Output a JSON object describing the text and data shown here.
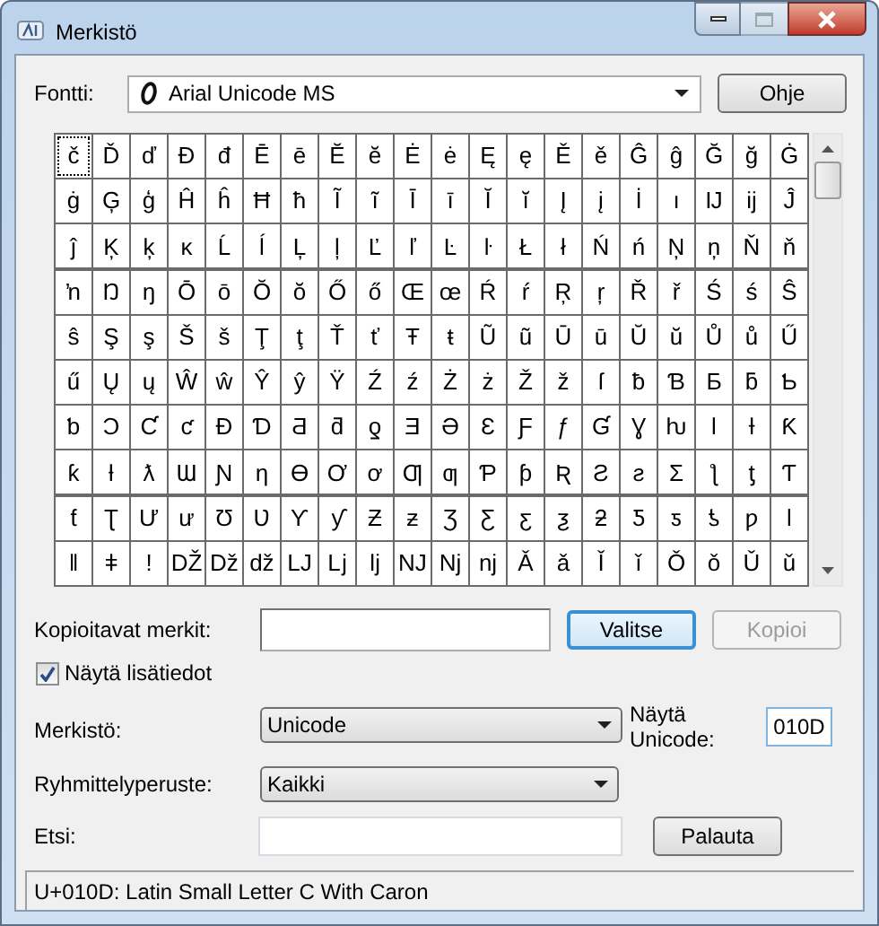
{
  "window": {
    "title": "Merkistö"
  },
  "font": {
    "label": "Fontti:",
    "value": "Arial Unicode MS"
  },
  "help_button": "Ohje",
  "grid": {
    "rows": [
      [
        {
          "char": "č",
          "selected": true
        },
        {
          "char": "Ď",
          "selected": false
        },
        {
          "char": "ď",
          "selected": false
        },
        {
          "char": "Đ",
          "selected": false
        },
        {
          "char": "đ",
          "selected": false
        },
        {
          "char": "Ē",
          "selected": false
        },
        {
          "char": "ē",
          "selected": false
        },
        {
          "char": "Ĕ",
          "selected": false
        },
        {
          "char": "ĕ",
          "selected": false
        },
        {
          "char": "Ė",
          "selected": false
        },
        {
          "char": "ė",
          "selected": false
        },
        {
          "char": "Ę",
          "selected": false
        },
        {
          "char": "ę",
          "selected": false
        },
        {
          "char": "Ě",
          "selected": false
        },
        {
          "char": "ě",
          "selected": false
        },
        {
          "char": "Ĝ",
          "selected": false
        },
        {
          "char": "ĝ",
          "selected": false
        },
        {
          "char": "Ğ",
          "selected": false
        },
        {
          "char": "ğ",
          "selected": false
        },
        {
          "char": "Ġ",
          "selected": false
        }
      ],
      [
        {
          "char": "ġ",
          "selected": false
        },
        {
          "char": "Ģ",
          "selected": false
        },
        {
          "char": "ģ",
          "selected": false
        },
        {
          "char": "Ĥ",
          "selected": false
        },
        {
          "char": "ĥ",
          "selected": false
        },
        {
          "char": "Ħ",
          "selected": false
        },
        {
          "char": "ħ",
          "selected": false
        },
        {
          "char": "Ĩ",
          "selected": false
        },
        {
          "char": "ĩ",
          "selected": false
        },
        {
          "char": "Ī",
          "selected": false
        },
        {
          "char": "ī",
          "selected": false
        },
        {
          "char": "Ĭ",
          "selected": false
        },
        {
          "char": "ĭ",
          "selected": false
        },
        {
          "char": "Į",
          "selected": false
        },
        {
          "char": "į",
          "selected": false
        },
        {
          "char": "İ",
          "selected": false
        },
        {
          "char": "ı",
          "selected": false
        },
        {
          "char": "Ĳ",
          "selected": false
        },
        {
          "char": "ĳ",
          "selected": false
        },
        {
          "char": "Ĵ",
          "selected": false
        }
      ],
      [
        {
          "char": "ĵ",
          "selected": false
        },
        {
          "char": "Ķ",
          "selected": false
        },
        {
          "char": "ķ",
          "selected": false
        },
        {
          "char": "ĸ",
          "selected": false
        },
        {
          "char": "Ĺ",
          "selected": false
        },
        {
          "char": "ĺ",
          "selected": false
        },
        {
          "char": "Ļ",
          "selected": false
        },
        {
          "char": "ļ",
          "selected": false
        },
        {
          "char": "Ľ",
          "selected": false
        },
        {
          "char": "ľ",
          "selected": false
        },
        {
          "char": "Ŀ",
          "selected": false
        },
        {
          "char": "ŀ",
          "selected": false
        },
        {
          "char": "Ł",
          "selected": false
        },
        {
          "char": "ł",
          "selected": false
        },
        {
          "char": "Ń",
          "selected": false
        },
        {
          "char": "ń",
          "selected": false
        },
        {
          "char": "Ņ",
          "selected": false
        },
        {
          "char": "ņ",
          "selected": false
        },
        {
          "char": "Ň",
          "selected": false
        },
        {
          "char": "ň",
          "selected": false
        }
      ],
      [
        {
          "char": "ŉ",
          "selected": false
        },
        {
          "char": "Ŋ",
          "selected": false
        },
        {
          "char": "ŋ",
          "selected": false
        },
        {
          "char": "Ō",
          "selected": false
        },
        {
          "char": "ō",
          "selected": false
        },
        {
          "char": "Ŏ",
          "selected": false
        },
        {
          "char": "ŏ",
          "selected": false
        },
        {
          "char": "Ő",
          "selected": false
        },
        {
          "char": "ő",
          "selected": false
        },
        {
          "char": "Œ",
          "selected": false
        },
        {
          "char": "œ",
          "selected": false
        },
        {
          "char": "Ŕ",
          "selected": false
        },
        {
          "char": "ŕ",
          "selected": false
        },
        {
          "char": "Ŗ",
          "selected": false
        },
        {
          "char": "ŗ",
          "selected": false
        },
        {
          "char": "Ř",
          "selected": false
        },
        {
          "char": "ř",
          "selected": false
        },
        {
          "char": "Ś",
          "selected": false
        },
        {
          "char": "ś",
          "selected": false
        },
        {
          "char": "Ŝ",
          "selected": false
        }
      ],
      [
        {
          "char": "ŝ",
          "selected": false
        },
        {
          "char": "Ş",
          "selected": false
        },
        {
          "char": "ş",
          "selected": false
        },
        {
          "char": "Š",
          "selected": false
        },
        {
          "char": "š",
          "selected": false
        },
        {
          "char": "Ţ",
          "selected": false
        },
        {
          "char": "ţ",
          "selected": false
        },
        {
          "char": "Ť",
          "selected": false
        },
        {
          "char": "ť",
          "selected": false
        },
        {
          "char": "Ŧ",
          "selected": false
        },
        {
          "char": "ŧ",
          "selected": false
        },
        {
          "char": "Ũ",
          "selected": false
        },
        {
          "char": "ũ",
          "selected": false
        },
        {
          "char": "Ū",
          "selected": false
        },
        {
          "char": "ū",
          "selected": false
        },
        {
          "char": "Ŭ",
          "selected": false
        },
        {
          "char": "ŭ",
          "selected": false
        },
        {
          "char": "Ů",
          "selected": false
        },
        {
          "char": "ů",
          "selected": false
        },
        {
          "char": "Ű",
          "selected": false
        }
      ],
      [
        {
          "char": "ű",
          "selected": false
        },
        {
          "char": "Ų",
          "selected": false
        },
        {
          "char": "ų",
          "selected": false
        },
        {
          "char": "Ŵ",
          "selected": false
        },
        {
          "char": "ŵ",
          "selected": false
        },
        {
          "char": "Ŷ",
          "selected": false
        },
        {
          "char": "ŷ",
          "selected": false
        },
        {
          "char": "Ÿ",
          "selected": false
        },
        {
          "char": "Ź",
          "selected": false
        },
        {
          "char": "ź",
          "selected": false
        },
        {
          "char": "Ż",
          "selected": false
        },
        {
          "char": "ż",
          "selected": false
        },
        {
          "char": "Ž",
          "selected": false
        },
        {
          "char": "ž",
          "selected": false
        },
        {
          "char": "ſ",
          "selected": false
        },
        {
          "char": "ƀ",
          "selected": false
        },
        {
          "char": "Ɓ",
          "selected": false
        },
        {
          "char": "Ƃ",
          "selected": false
        },
        {
          "char": "ƃ",
          "selected": false
        },
        {
          "char": "Ƅ",
          "selected": false
        }
      ],
      [
        {
          "char": "ƅ",
          "selected": false
        },
        {
          "char": "Ɔ",
          "selected": false
        },
        {
          "char": "Ƈ",
          "selected": false
        },
        {
          "char": "ƈ",
          "selected": false
        },
        {
          "char": "Ɖ",
          "selected": false
        },
        {
          "char": "Ɗ",
          "selected": false
        },
        {
          "char": "Ƌ",
          "selected": false
        },
        {
          "char": "ƌ",
          "selected": false
        },
        {
          "char": "ƍ",
          "selected": false
        },
        {
          "char": "Ǝ",
          "selected": false
        },
        {
          "char": "Ə",
          "selected": false
        },
        {
          "char": "Ɛ",
          "selected": false
        },
        {
          "char": "Ƒ",
          "selected": false
        },
        {
          "char": "ƒ",
          "selected": false
        },
        {
          "char": "Ɠ",
          "selected": false
        },
        {
          "char": "Ɣ",
          "selected": false
        },
        {
          "char": "ƕ",
          "selected": false
        },
        {
          "char": "Ɩ",
          "selected": false
        },
        {
          "char": "Ɨ",
          "selected": false
        },
        {
          "char": "Ƙ",
          "selected": false
        }
      ],
      [
        {
          "char": "ƙ",
          "selected": false
        },
        {
          "char": "ƚ",
          "selected": false
        },
        {
          "char": "ƛ",
          "selected": false
        },
        {
          "char": "Ɯ",
          "selected": false
        },
        {
          "char": "Ɲ",
          "selected": false
        },
        {
          "char": "ƞ",
          "selected": false
        },
        {
          "char": "Ɵ",
          "selected": false
        },
        {
          "char": "Ơ",
          "selected": false
        },
        {
          "char": "ơ",
          "selected": false
        },
        {
          "char": "Ƣ",
          "selected": false
        },
        {
          "char": "ƣ",
          "selected": false
        },
        {
          "char": "Ƥ",
          "selected": false
        },
        {
          "char": "ƥ",
          "selected": false
        },
        {
          "char": "Ʀ",
          "selected": false
        },
        {
          "char": "Ƨ",
          "selected": false
        },
        {
          "char": "ƨ",
          "selected": false
        },
        {
          "char": "Ʃ",
          "selected": false
        },
        {
          "char": "ƪ",
          "selected": false
        },
        {
          "char": "ƫ",
          "selected": false
        },
        {
          "char": "Ƭ",
          "selected": false
        }
      ],
      [
        {
          "char": "ƭ",
          "selected": false
        },
        {
          "char": "Ʈ",
          "selected": false
        },
        {
          "char": "Ư",
          "selected": false
        },
        {
          "char": "ư",
          "selected": false
        },
        {
          "char": "Ʊ",
          "selected": false
        },
        {
          "char": "Ʋ",
          "selected": false
        },
        {
          "char": "Ƴ",
          "selected": false
        },
        {
          "char": "ƴ",
          "selected": false
        },
        {
          "char": "Ƶ",
          "selected": false
        },
        {
          "char": "ƶ",
          "selected": false
        },
        {
          "char": "Ʒ",
          "selected": false
        },
        {
          "char": "Ƹ",
          "selected": false
        },
        {
          "char": "ƹ",
          "selected": false
        },
        {
          "char": "ƺ",
          "selected": false
        },
        {
          "char": "ƻ",
          "selected": false
        },
        {
          "char": "Ƽ",
          "selected": false
        },
        {
          "char": "ƽ",
          "selected": false
        },
        {
          "char": "ƾ",
          "selected": false
        },
        {
          "char": "ƿ",
          "selected": false
        },
        {
          "char": "ǀ",
          "selected": false
        }
      ],
      [
        {
          "char": "ǁ",
          "selected": false
        },
        {
          "char": "ǂ",
          "selected": false
        },
        {
          "char": "ǃ",
          "selected": false
        },
        {
          "char": "Ǆ",
          "selected": false
        },
        {
          "char": "ǅ",
          "selected": false
        },
        {
          "char": "ǆ",
          "selected": false
        },
        {
          "char": "Ǉ",
          "selected": false
        },
        {
          "char": "ǈ",
          "selected": false
        },
        {
          "char": "ǉ",
          "selected": false
        },
        {
          "char": "Ǌ",
          "selected": false
        },
        {
          "char": "ǋ",
          "selected": false
        },
        {
          "char": "ǌ",
          "selected": false
        },
        {
          "char": "Ǎ",
          "selected": false
        },
        {
          "char": "ǎ",
          "selected": false
        },
        {
          "char": "Ǐ",
          "selected": false
        },
        {
          "char": "ǐ",
          "selected": false
        },
        {
          "char": "Ǒ",
          "selected": false
        },
        {
          "char": "ǒ",
          "selected": false
        },
        {
          "char": "Ǔ",
          "selected": false
        },
        {
          "char": "ǔ",
          "selected": false
        }
      ]
    ]
  },
  "copy": {
    "label": "Kopioitavat merkit:",
    "select_button": "Valitse",
    "copy_button": {
      "label": "Kopioi",
      "disabled": true
    }
  },
  "advanced": {
    "label": "Näytä lisätiedot",
    "checked": true
  },
  "charset": {
    "label": "Merkistö:",
    "value": "Unicode"
  },
  "goto_unicode": {
    "label": "Näytä Unicode:",
    "value": "010D"
  },
  "group_by": {
    "label": "Ryhmittelyperuste:",
    "value": "Kaikki"
  },
  "search": {
    "label": "Etsi:"
  },
  "reset_button": "Palauta",
  "status_bar": "U+010D: Latin Small Letter C With Caron"
}
